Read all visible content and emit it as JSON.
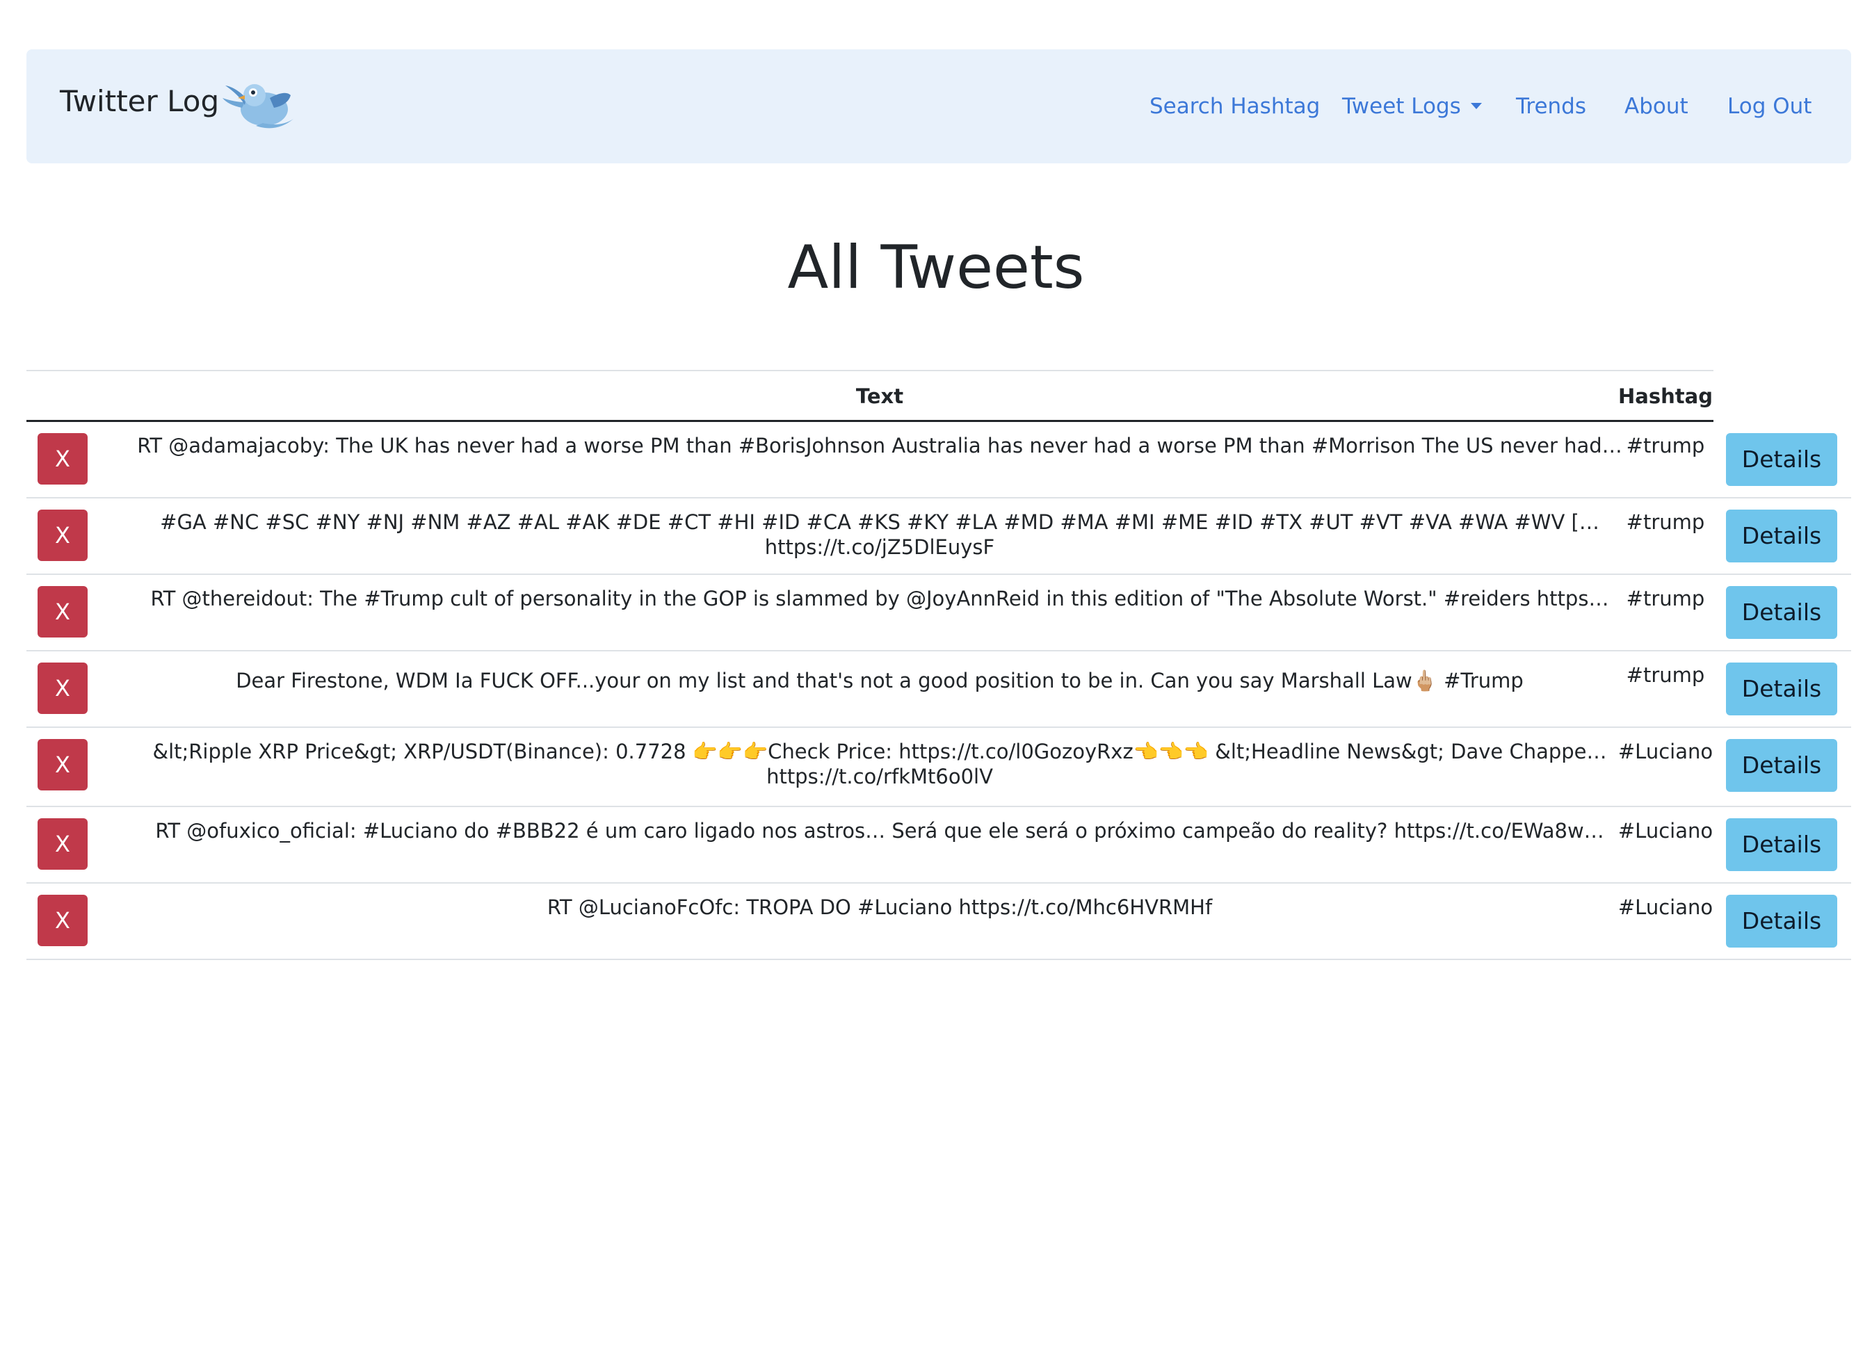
{
  "navbar": {
    "brand": "Twitter Log",
    "links": {
      "search": "Search Hashtag",
      "tweet_logs": "Tweet Logs",
      "trends": "Trends",
      "about": "About",
      "logout": "Log Out"
    }
  },
  "page": {
    "title": "All Tweets"
  },
  "table": {
    "headers": {
      "text": "Text",
      "hashtag": "Hashtag"
    },
    "delete_label": "X",
    "details_label": "Details",
    "rows": [
      {
        "line1": "RT @adamajacoby: The UK has never had a worse PM than #BorisJohnson Australia has never had a worse PM than #Morrison The US never had…",
        "line2": "",
        "hashtag": "#trump"
      },
      {
        "line1": "#GA #NC #SC #NY #NJ #NM #AZ #AL #AK #DE #CT #HI #ID #CA #KS #KY #LA #MD #MA #MI #ME #ID #TX #UT #VT #VA #WA #WV […",
        "line2": "https://t.co/jZ5DlEuysF",
        "hashtag": "#trump"
      },
      {
        "line1": "RT @thereidout: The #Trump cult of personality in the GOP is slammed by @JoyAnnReid in this edition of \"The Absolute Worst.\" #reiders https…",
        "line2": "",
        "hashtag": "#trump"
      },
      {
        "line1": "Dear Firestone, WDM Ia FUCK OFF...your on my list and that's not a good position to be in. Can you say Marshall Law🖕🏼 #Trump",
        "line2": "",
        "hashtag": "#trump"
      },
      {
        "line1": "&lt;Ripple XRP Price&gt; XRP/USDT(Binance): 0.7728 👉👉👉Check Price: https://t.co/l0GozoyRxz👈👈👈  &lt;Headline News&gt; Dave Chappe…",
        "line2": "https://t.co/rfkMt6o0lV",
        "hashtag": "#Luciano"
      },
      {
        "line1": "RT @ofuxico_oficial: #Luciano do #BBB22 é um caro ligado nos astros… Será que ele será o próximo campeão do reality? https://t.co/EWa8w…",
        "line2": "",
        "hashtag": "#Luciano"
      },
      {
        "line1": "RT @LucianoFcOfc: TROPA DO #Luciano https://t.co/Mhc6HVRMHf",
        "line2": "",
        "hashtag": "#Luciano"
      }
    ]
  }
}
